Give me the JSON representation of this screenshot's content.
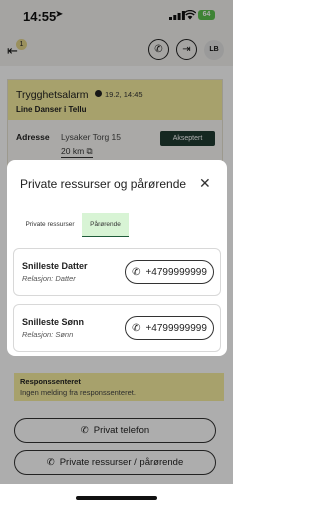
{
  "status_bar": {
    "time": "14:55",
    "battery": "64"
  },
  "header": {
    "back_badge": "1",
    "avatar": "LB"
  },
  "alarm": {
    "title": "Trygghetsalarm",
    "time": "19.2, 14:45",
    "name": "Line Danser i Tellu",
    "address_label": "Adresse",
    "address": "Lysaker Torg 15",
    "distance": "20 km",
    "status": "Akseptert"
  },
  "response_center": {
    "title": "Responssenteret",
    "text": "Ingen melding fra responssenteret."
  },
  "buttons": {
    "private_phone": "Privat telefon",
    "private_resources": "Private ressurser / pårørende"
  },
  "modal": {
    "title": "Private ressurser og pårørende",
    "tabs": [
      {
        "label": "Private ressurser",
        "active": false
      },
      {
        "label": "Pårørende",
        "active": true
      }
    ],
    "contacts": [
      {
        "name": "Snilleste Datter",
        "relation": "Relasjon: Datter",
        "phone": "+4799999999"
      },
      {
        "name": "Snilleste Sønn",
        "relation": "Relasjon: Sønn",
        "phone": "+4799999999"
      }
    ]
  },
  "colors": {
    "accent_yellow": "#f6ee9f",
    "status_green": "#1f3b32",
    "active_tab": "#d8f4d5"
  }
}
